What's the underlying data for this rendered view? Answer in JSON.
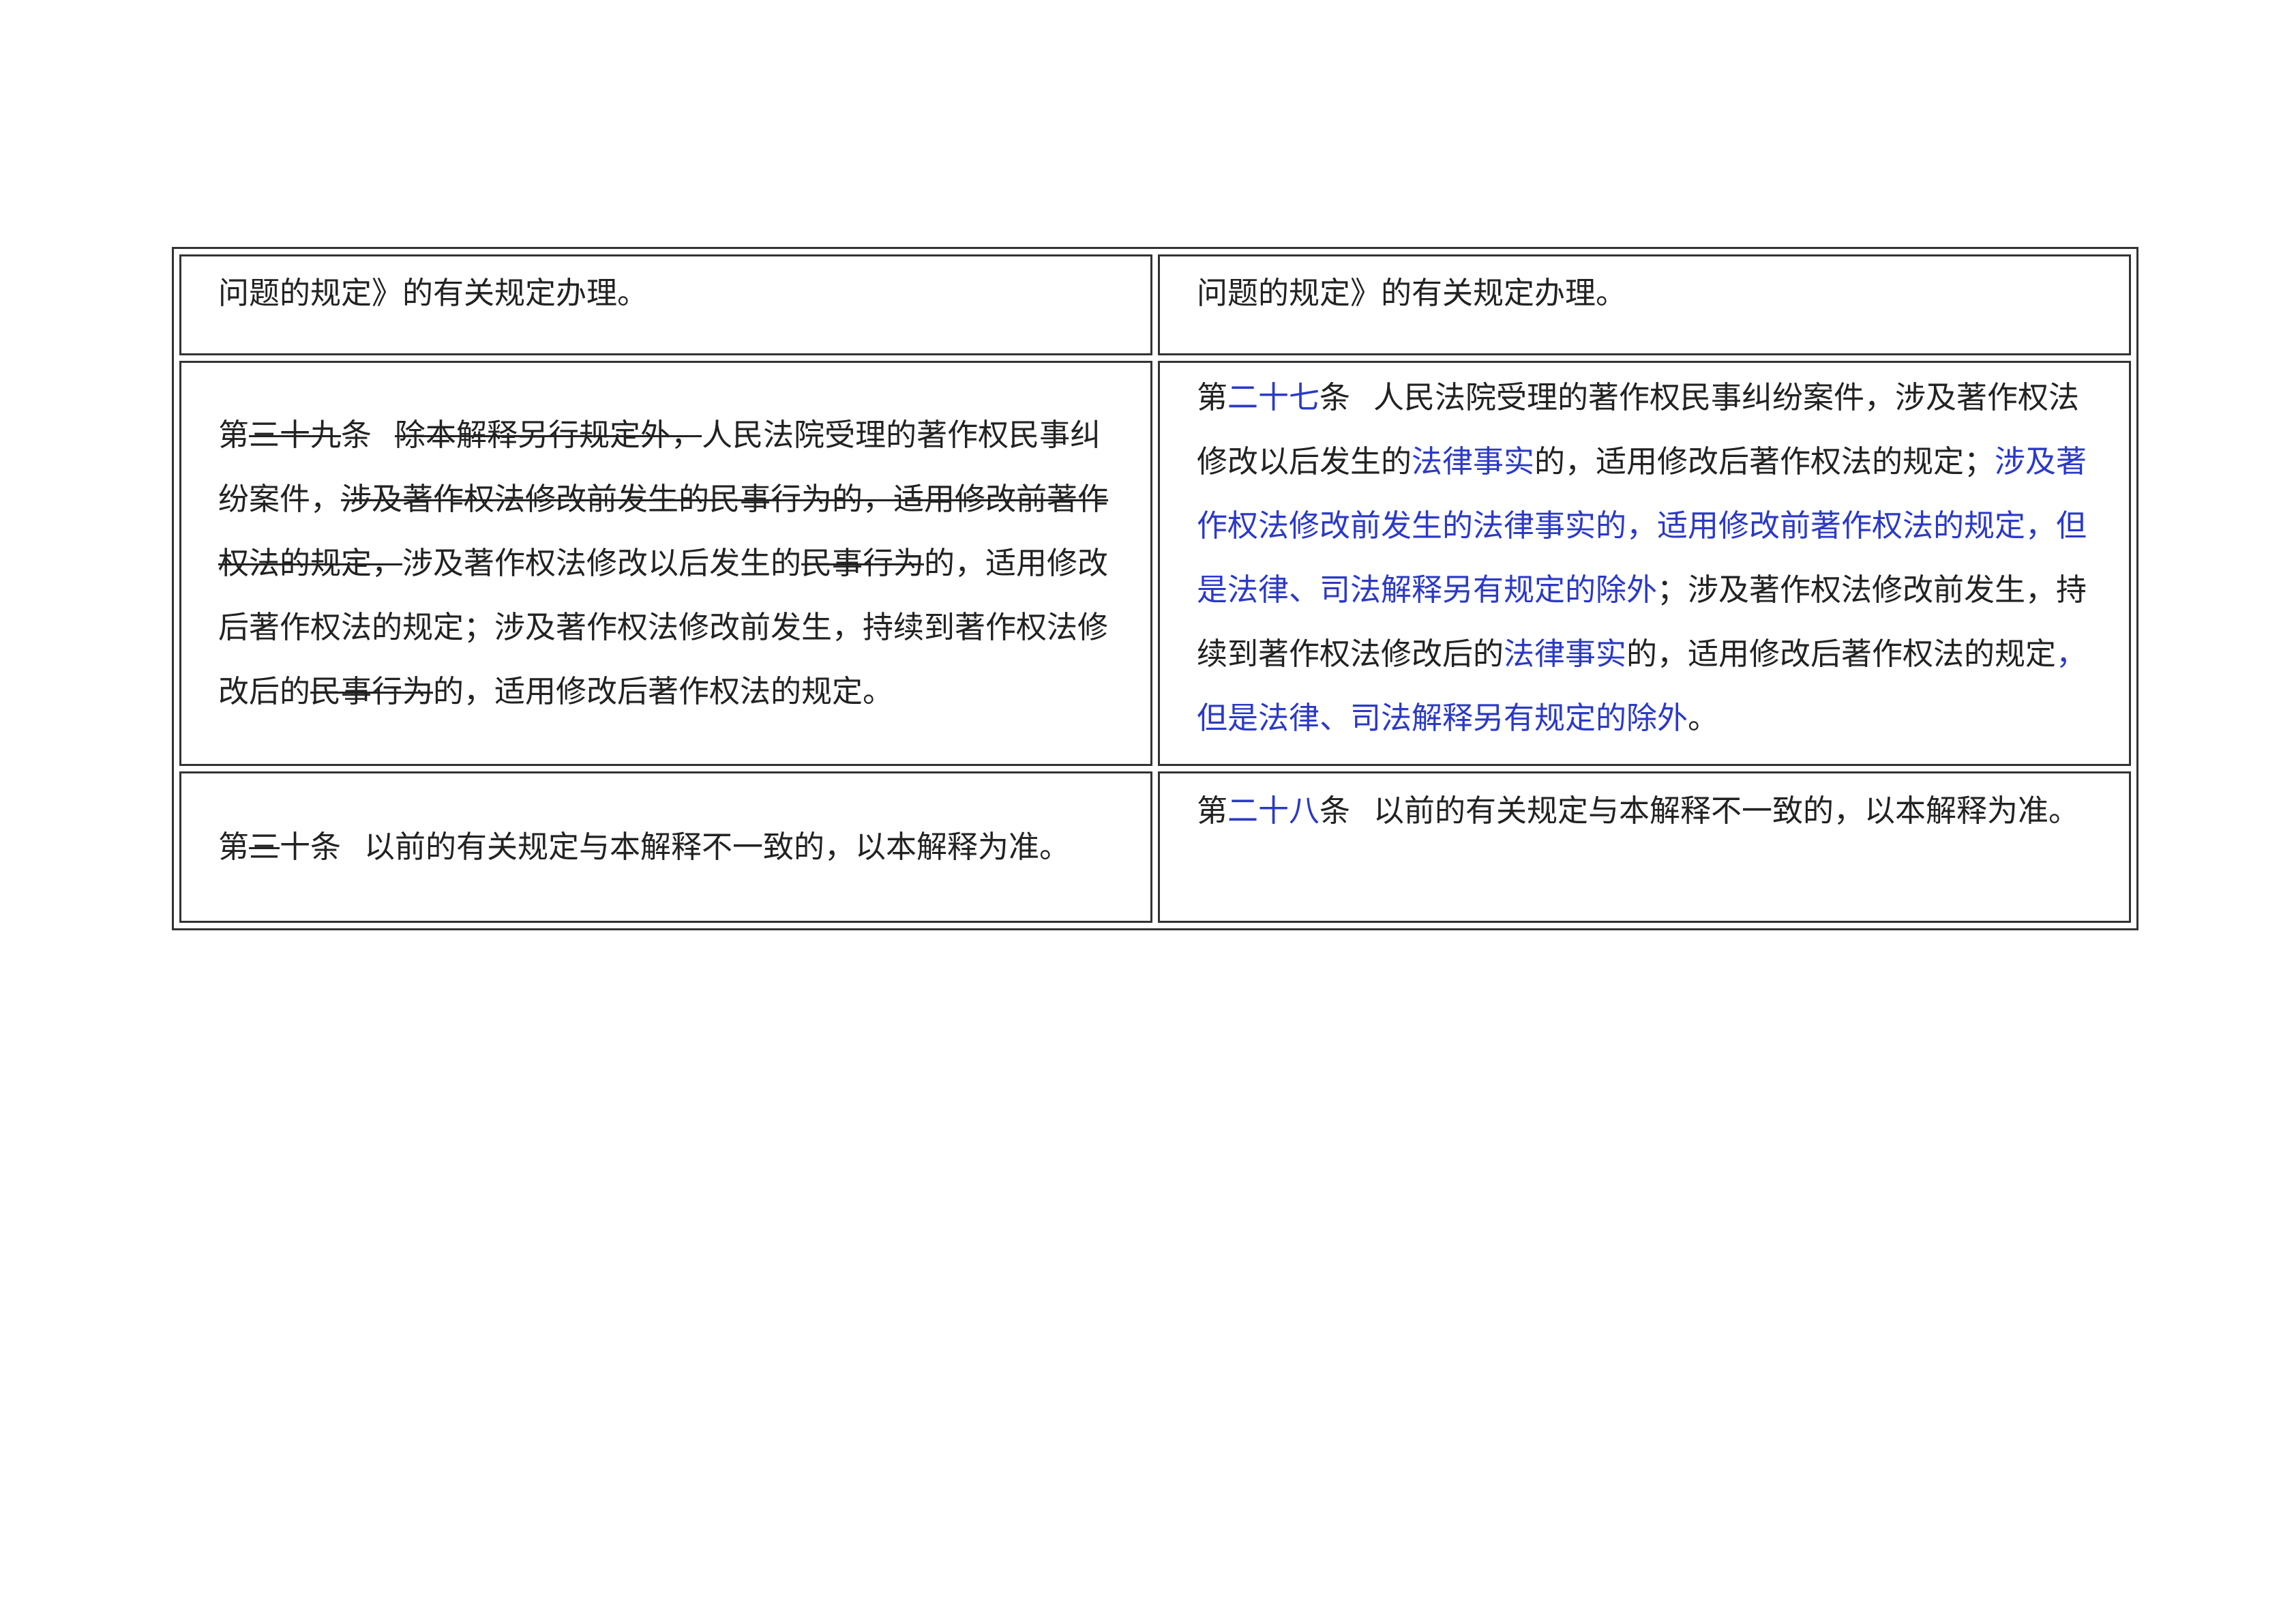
{
  "table": {
    "rows": [
      {
        "left": [
          {
            "text": "问题的规定》的有关规定办理。",
            "style": "normal"
          }
        ],
        "right": [
          {
            "text": "问题的规定》的有关规定办理。",
            "style": "normal"
          }
        ]
      },
      {
        "left": [
          {
            "text": "第",
            "style": "normal"
          },
          {
            "text": "三十九",
            "style": "del"
          },
          {
            "text": "条",
            "style": "normal"
          },
          {
            "text": "除本解释另行规定外，",
            "style": "del"
          },
          {
            "text": "人民法院受理的著作权民事纠纷案件，",
            "style": "normal"
          },
          {
            "text": "涉及著作权法修改前发生的民事行为的，适用修改前著作权法的规定，",
            "style": "del"
          },
          {
            "text": "涉及著作权法修改以后发生的",
            "style": "normal"
          },
          {
            "text": "民事行为",
            "style": "del"
          },
          {
            "text": "的，适用修改后著作权法的规定；涉及著作权法修改前发生，持续到著作权法修改后的",
            "style": "normal"
          },
          {
            "text": "民事行为",
            "style": "del"
          },
          {
            "text": "的，适用修改后著作权法的规定。",
            "style": "normal"
          }
        ],
        "right": [
          {
            "text": "第",
            "style": "normal"
          },
          {
            "text": "二十七",
            "style": "ins"
          },
          {
            "text": "条",
            "style": "normal"
          },
          {
            "text": "人民法院受理的著作权民事纠纷案件，涉及著作权法修改以后发生的",
            "style": "normal"
          },
          {
            "text": "法律事实",
            "style": "ins"
          },
          {
            "text": "的，适用修改后著作权法的规定；",
            "style": "normal"
          },
          {
            "text": "涉及著作权法修改前发生的法律事实的，适用修改前著作权法的规定，但是法律、司法解释另有规定的除外",
            "style": "ins"
          },
          {
            "text": "；涉及著作权法修改前发生，持续到著作权法修改后的",
            "style": "normal"
          },
          {
            "text": "法律事实",
            "style": "ins"
          },
          {
            "text": "的，适用修改后著作权法的规定",
            "style": "normal"
          },
          {
            "text": "，但是法律、司法解释另有规定的除外",
            "style": "ins"
          },
          {
            "text": "。",
            "style": "normal"
          }
        ]
      },
      {
        "left": [
          {
            "text": "第",
            "style": "normal"
          },
          {
            "text": "三",
            "style": "del"
          },
          {
            "text": "十条",
            "style": "normal"
          },
          {
            "text": "以前的有关规定与本解释不一致的，以本解释为准。",
            "style": "normal"
          }
        ],
        "right": [
          {
            "text": "第",
            "style": "normal"
          },
          {
            "text": "二十八",
            "style": "ins"
          },
          {
            "text": "条",
            "style": "normal"
          },
          {
            "text": "以前的有关规定与本解释不一致的，以本解释为准。",
            "style": "normal"
          }
        ]
      }
    ]
  },
  "colors": {
    "inserted_text": "#2b39c8",
    "normal_text": "#222222",
    "border": "#333333"
  }
}
